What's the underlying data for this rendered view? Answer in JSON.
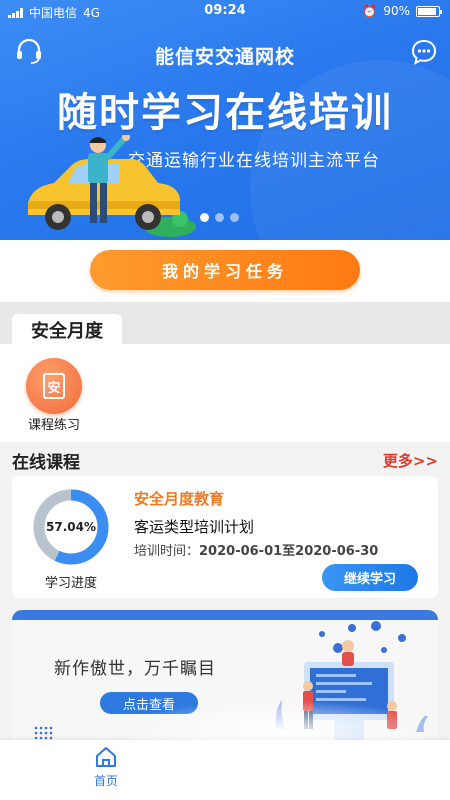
{
  "status_bar": {
    "carrier": "中国电信",
    "network": "4G",
    "time": "09:24",
    "battery": "90%"
  },
  "banner": {
    "school_name": "能信安交通网校",
    "slogan": "随时学习在线培训",
    "subtitle": "交通运输行业在线培训主流平台",
    "slide_count": 3,
    "active_slide": 1
  },
  "task_button": "我的学习任务",
  "safety": {
    "tab": "安全月度",
    "practice_icon_char": "安",
    "practice_label": "课程练习"
  },
  "online": {
    "title": "在线课程",
    "more": "更多>>",
    "course": {
      "progress_percent": 57.04,
      "progress_text": "57.04%",
      "progress_label": "学习进度",
      "tag": "安全月度教育",
      "name": "客运类型培训计划",
      "time_label": "培训时间：",
      "time_value": "2020-06-01至2020-06-30",
      "continue_label": "继续学习"
    },
    "promo": {
      "text": "新作傲世，万千瞩目",
      "button": "点击查看"
    }
  },
  "tab_bar": {
    "home_label": "首页"
  },
  "colors": {
    "brand_blue": "#2a79ee",
    "orange": "#ff8a1f",
    "more_red": "#e23b2b",
    "progress_fill": "#3a8ef2",
    "progress_track": "#b9c3cd"
  }
}
